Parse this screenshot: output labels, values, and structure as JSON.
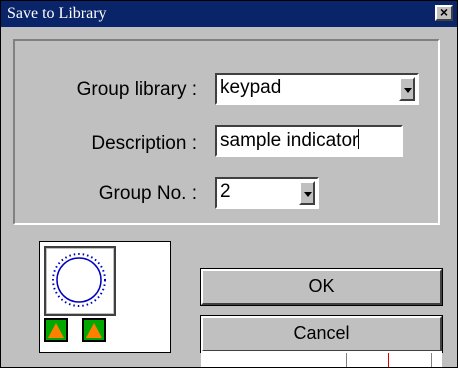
{
  "dialog": {
    "title": "Save to Library",
    "close_icon": "close-icon"
  },
  "form": {
    "group_library_label": "Group library :",
    "group_library_value": "keypad",
    "description_label": "Description :",
    "description_value": "sample indicator",
    "group_no_label": "Group No. :",
    "group_no_value": "2"
  },
  "preview": {
    "icon": "circular-gauge-icon",
    "arrow_icons": [
      "up-arrow-icon",
      "up-arrow-icon"
    ]
  },
  "buttons": {
    "ok_label": "OK",
    "cancel_label": "Cancel"
  }
}
